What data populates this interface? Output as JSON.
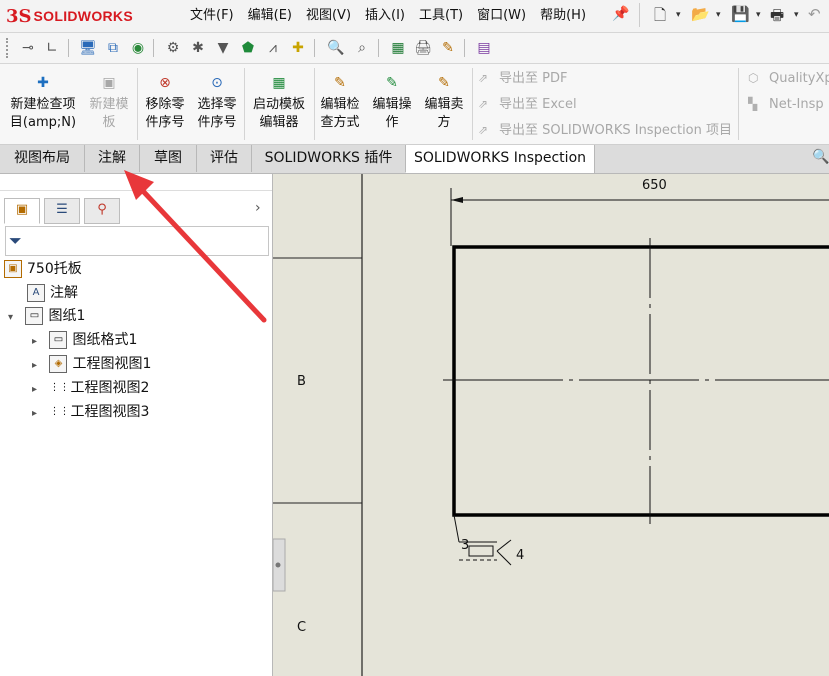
{
  "app": {
    "logo_ds": "3S",
    "logo_text": "SOLIDWORKS"
  },
  "menu": [
    "文件(F)",
    "编辑(E)",
    "视图(V)",
    "插入(I)",
    "工具(T)",
    "窗口(W)",
    "帮助(H)"
  ],
  "ribbon": {
    "new_check_project": [
      "新建检查项",
      "目(amp;N)"
    ],
    "new_template": [
      "新建模",
      "板"
    ],
    "remove_balloon": [
      "移除零",
      "件序号"
    ],
    "select_balloon": [
      "选择零",
      "件序号"
    ],
    "launch_template_editor": [
      "启动模板",
      "编辑器"
    ],
    "edit_check_method": [
      "编辑检",
      "查方式"
    ],
    "edit_operation": [
      "编辑操",
      "作"
    ],
    "edit_vendor": [
      "编辑卖",
      "方"
    ],
    "export_pdf": "导出至 PDF",
    "export_excel": "导出至 Excel",
    "export_project": "导出至 SOLIDWORKS Inspection 项目",
    "qualityxpert": "QualityXp",
    "net_inspect": "Net-Insp"
  },
  "tabs": [
    "视图布局",
    "注解",
    "草图",
    "评估",
    "SOLIDWORKS 插件",
    "SOLIDWORKS Inspection"
  ],
  "active_tab": "SOLIDWORKS Inspection",
  "tree": {
    "root": "750托板",
    "annotations": "注解",
    "sheet": "图纸1",
    "children": [
      "图纸格式1",
      "工程图视图1",
      "工程图视图2",
      "工程图视图3"
    ]
  },
  "drawing": {
    "dimension": "650",
    "zone_b": "B",
    "zone_c": "C",
    "weld_num_left": "3",
    "weld_num_right": "4"
  },
  "colors": {
    "accent_red": "#e8373a",
    "brand_red": "#d71920",
    "canvas": "#e5e4d9"
  }
}
